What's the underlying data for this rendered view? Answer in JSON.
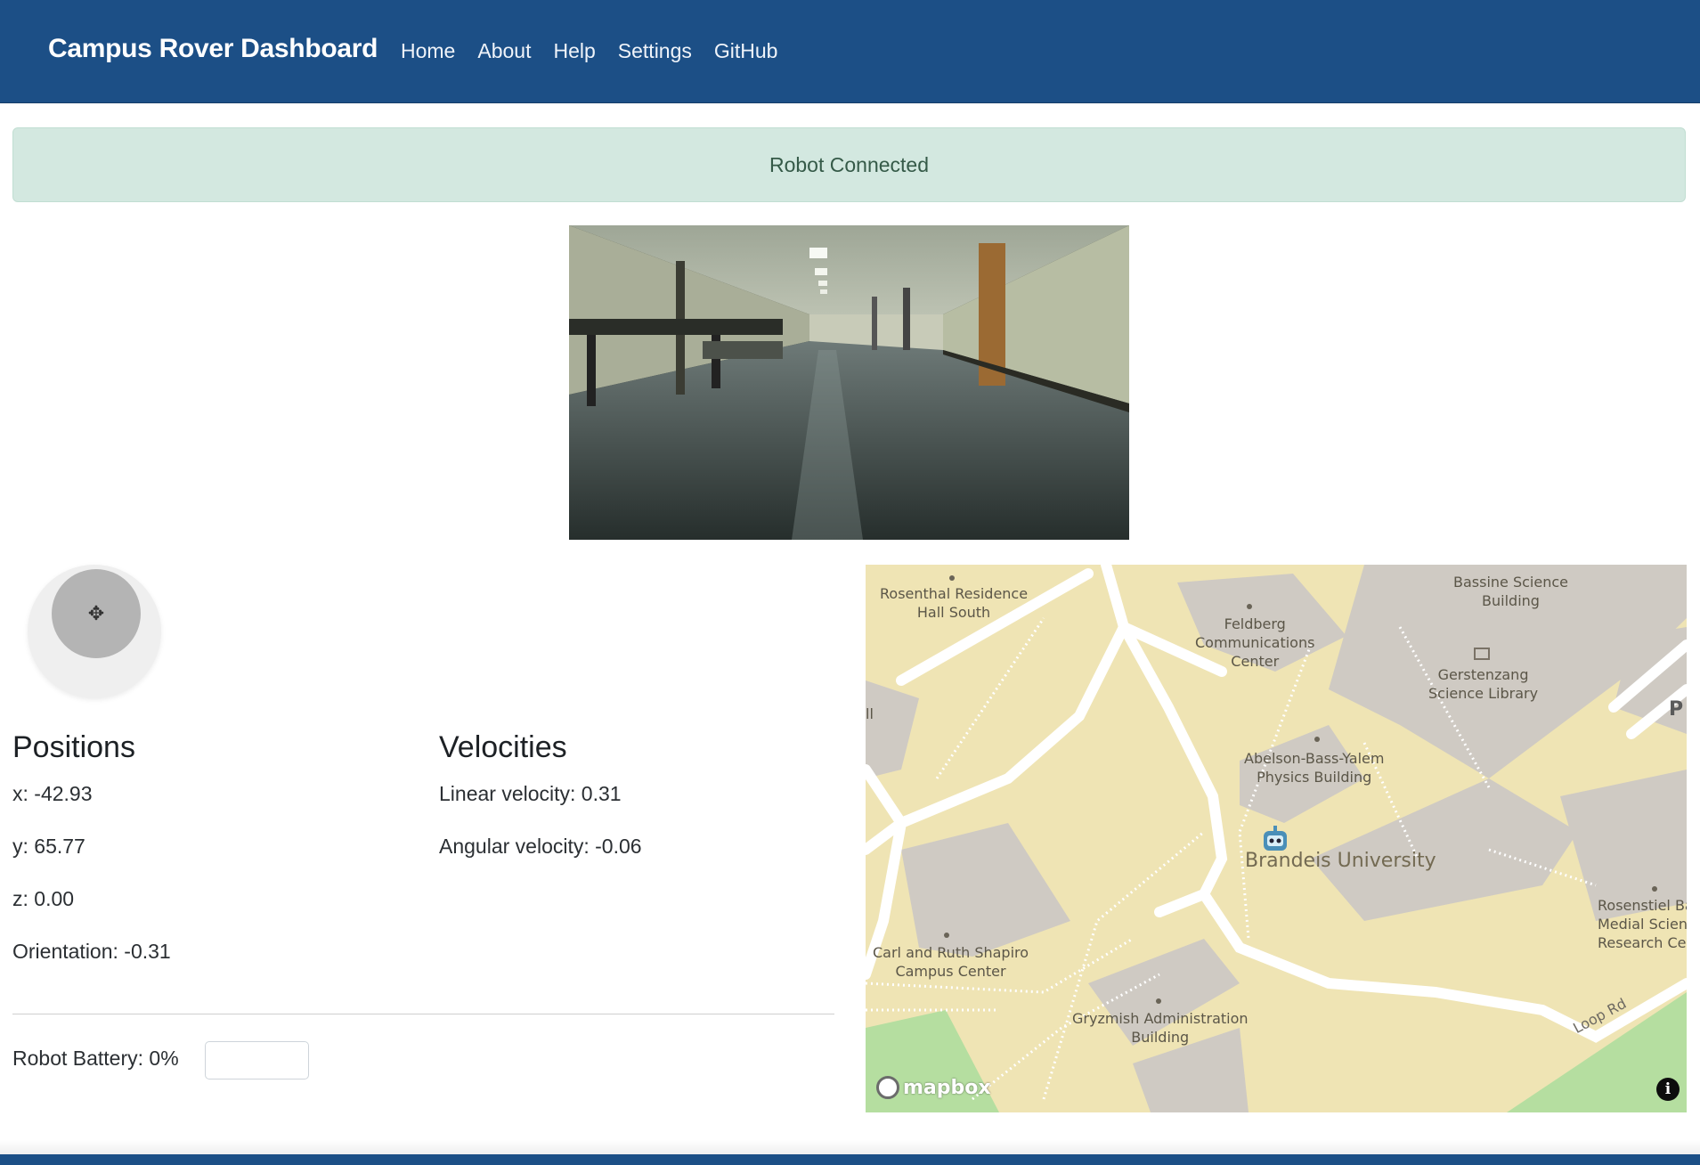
{
  "navbar": {
    "brand": "Campus Rover Dashboard",
    "links": [
      "Home",
      "About",
      "Help",
      "Settings",
      "GitHub"
    ]
  },
  "alert": {
    "text": "Robot Connected",
    "color": "#d3e8e0"
  },
  "positions": {
    "heading": "Positions",
    "x": "x: -42.93",
    "y": "y: 65.77",
    "z": "z: 0.00",
    "orientation": "Orientation: -0.31"
  },
  "velocities": {
    "heading": "Velocities",
    "linear": "Linear velocity: 0.31",
    "angular": "Angular velocity: -0.06"
  },
  "battery": {
    "label": "Robot Battery: 0%",
    "input_value": ""
  },
  "joystick": {
    "icon": "move-icon"
  },
  "map": {
    "labels": {
      "rosenthal": "Rosenthal Residence\nHall South",
      "feldberg": "Feldberg\nCommunications\nCenter",
      "bassine": "Bassine Science\nBuilding",
      "gerstenzang": "Gerstenzang\nScience Library",
      "abelson": "Abelson-Bass-Yalem\nPhysics Building",
      "brandeis": "Brandeis University",
      "rosenstiel": "Rosenstiel Ba\nMedial Scien\nResearch Cen",
      "shapiro": "Carl and Ruth Shapiro\nCampus Center",
      "gryzmish": "Gryzmish Administration\nBuilding",
      "loop": "Loop Rd",
      "p": "P",
      "ll": "ll"
    },
    "attribution": "mapbox",
    "info": "i"
  },
  "colors": {
    "navbar": "#1c4f86",
    "alert_text": "#355a48",
    "map_land": "#efe4b4",
    "map_building": "#cfcac3",
    "map_green": "#b5dea0"
  }
}
